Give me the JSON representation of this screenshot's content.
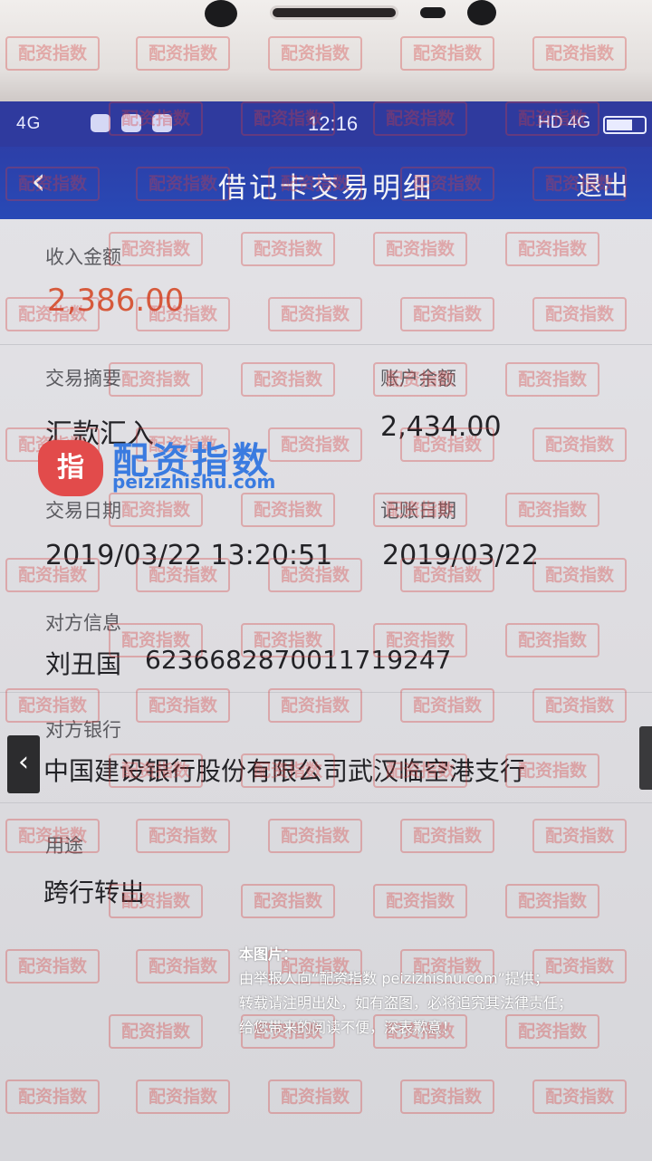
{
  "status_bar": {
    "network_left": "4G",
    "time": "12:16",
    "network_right": "HD 4G"
  },
  "nav": {
    "back_glyph": "‹",
    "title": "借记卡交易明细",
    "exit_label": "退出"
  },
  "detail": {
    "income_label": "收入金额",
    "income_value": "2,386.00",
    "summary_label": "交易摘要",
    "summary_value": "汇款汇入",
    "balance_label": "账户余额",
    "balance_value": "2,434.00",
    "trade_date_label": "交易日期",
    "trade_date_value": "2019/03/22 13:20:51",
    "post_date_label": "记账日期",
    "post_date_value": "2019/03/22",
    "counterparty_label": "对方信息",
    "counterparty_name": "刘丑国",
    "counterparty_account": "6236682870011719247",
    "bank_label": "对方银行",
    "bank_value": "中国建设银行股份有限公司武汉临空港支行",
    "purpose_label": "用途",
    "purpose_value": "跨行转出"
  },
  "watermark": {
    "tile_text": "配资指数",
    "logo_badge": "指",
    "logo_cn": "配资指数",
    "logo_url": "peizizhishu.com"
  },
  "notice": {
    "line1": "本图片：",
    "line2": "由举报人向“配资指数 peizizhishu.com”提供；",
    "line3": "转载请注明出处，如有盗图，必将追究其法律责任；",
    "line4": "给您带来的阅读不便，深表歉意！"
  },
  "colors": {
    "nav_bg": "#2849b6",
    "amount": "#d65a3c",
    "watermark_red": "#d63c3c",
    "logo_blue": "#3a7be0"
  }
}
